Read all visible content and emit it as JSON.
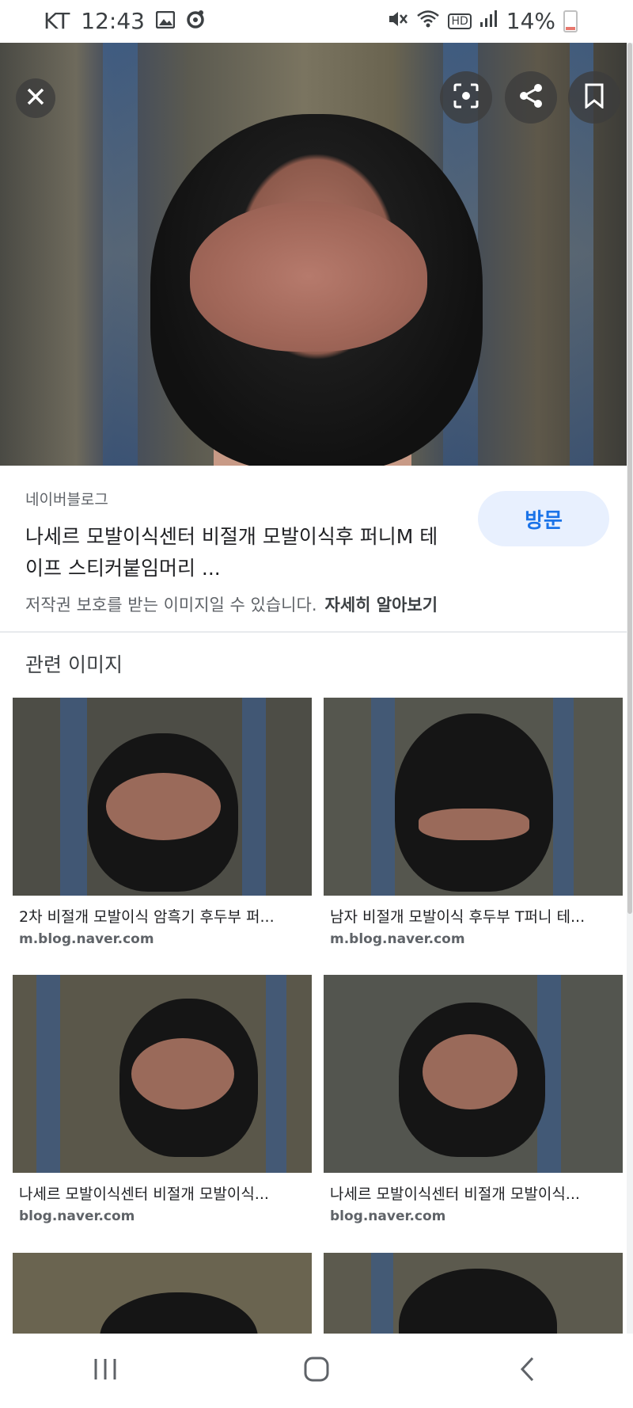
{
  "status_bar": {
    "carrier": "KT",
    "time": "12:43",
    "battery": "14%",
    "hd_label": "HD"
  },
  "hero": {
    "close_icon": "close-icon",
    "lens_icon": "lens-scan-icon",
    "share_icon": "share-icon",
    "bookmark_icon": "bookmark-icon"
  },
  "info": {
    "source": "네이버블로그",
    "title": "나세르 모발이식센터 비절개 모발이식후 퍼니M 테이프 스티커붙임머리 ...",
    "visit_label": "방문",
    "copyright_text": "저작권 보호를 받는 이미지일 수 있습니다.",
    "learn_more": "자세히 알아보기"
  },
  "related": {
    "title": "관련 이미지",
    "items": [
      {
        "caption": "2차 비절개 모발이식 암흑기 후두부 퍼...",
        "domain": "m.blog.naver.com"
      },
      {
        "caption": "남자 비절개 모발이식 후두부 T퍼니 테...",
        "domain": "m.blog.naver.com"
      },
      {
        "caption": "나세르 모발이식센터 비절개 모발이식...",
        "domain": "blog.naver.com"
      },
      {
        "caption": "나세르 모발이식센터 비절개 모발이식...",
        "domain": "blog.naver.com"
      }
    ]
  },
  "navbar": {
    "recent_icon": "recent-apps-icon",
    "home_icon": "home-icon",
    "back_icon": "back-icon"
  }
}
